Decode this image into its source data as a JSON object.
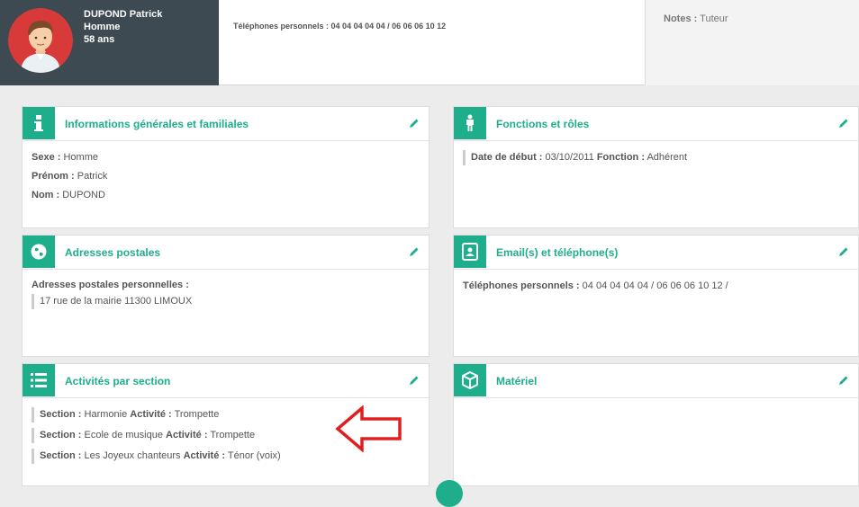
{
  "profile": {
    "name": "DUPOND Patrick",
    "gender": "Homme",
    "age": "58 ans",
    "avatar_icon": "user-avatar-icon"
  },
  "header": {
    "phones_label": "Téléphones personnels :",
    "phones_value": "04 04 04 04 04 / 06 06 06 10 12",
    "notes_label": "Notes :",
    "notes_value": "Tuteur"
  },
  "panels": {
    "general": {
      "title": "Informations générales et familiales",
      "icon": "info-icon",
      "fields": [
        {
          "label": "Sexe :",
          "value": "Homme"
        },
        {
          "label": "Prénom :",
          "value": "Patrick"
        },
        {
          "label": "Nom :",
          "value": "DUPOND"
        }
      ]
    },
    "roles": {
      "title": "Fonctions et rôles",
      "icon": "person-icon",
      "start_label": "Date de début :",
      "start_value": "03/10/2011",
      "function_label": "Fonction :",
      "function_value": "Adhérent"
    },
    "addresses": {
      "title": "Adresses postales",
      "icon": "globe-icon",
      "label": "Adresses postales personnelles :",
      "value": "17 rue de la mairie 11300 LIMOUX"
    },
    "contact": {
      "title": "Email(s) et téléphone(s)",
      "icon": "contact-card-icon",
      "label": "Téléphones personnels :",
      "value": "04 04 04 04 04 / 06 06 06 10 12 /"
    },
    "activities": {
      "title": "Activités par section",
      "icon": "list-icon",
      "section_label": "Section :",
      "activity_label": "Activité :",
      "items": [
        {
          "section": "Harmonie",
          "activity": "Trompette"
        },
        {
          "section": "Ecole de musique",
          "activity": "Trompette"
        },
        {
          "section": "Les Joyeux chanteurs",
          "activity": "Ténor (voix)"
        }
      ]
    },
    "equipment": {
      "title": "Matériel",
      "icon": "box-icon"
    }
  },
  "colors": {
    "accent": "#1fae8b",
    "profile_bg": "#3d4a51",
    "arrow": "#e02020"
  }
}
